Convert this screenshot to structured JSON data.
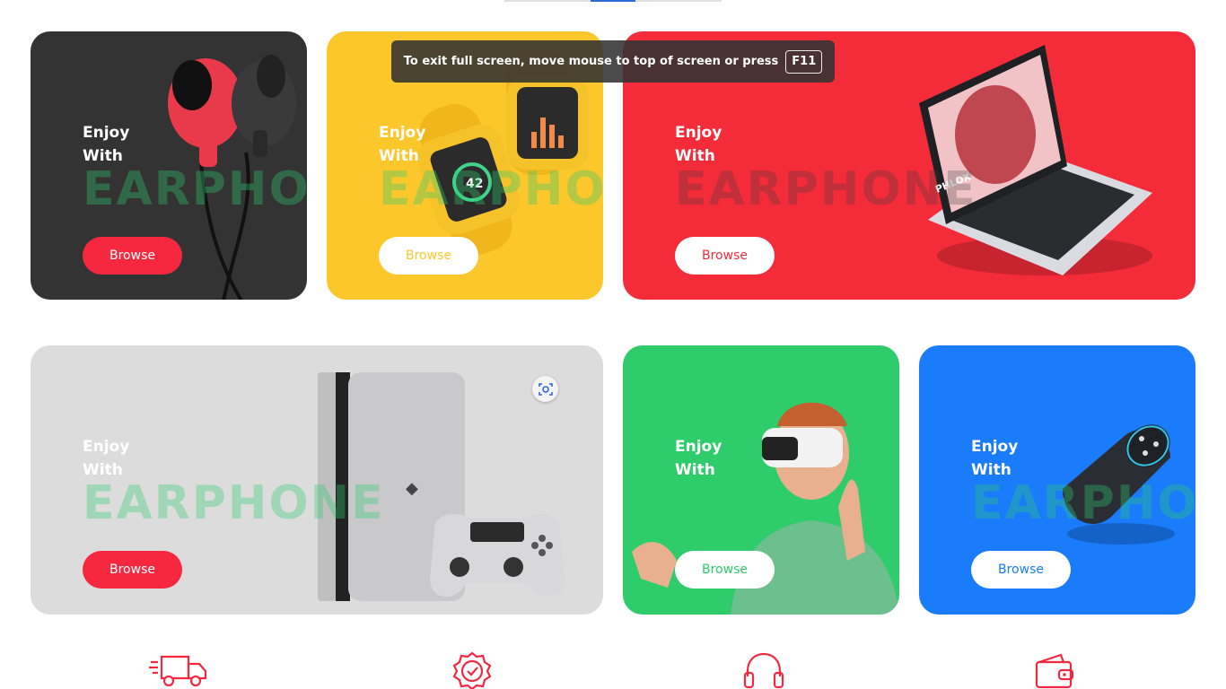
{
  "toast": {
    "message": "To exit full screen, move mouse to top of screen or press",
    "key": "F11"
  },
  "cards": [
    {
      "enjoy": "Enjoy",
      "with": "With",
      "watermark": "EARPHO",
      "button": "Browse",
      "bg": "#333333",
      "button_bg": "#f5283f",
      "button_color": "#ffffff"
    },
    {
      "enjoy": "Enjoy",
      "with": "With",
      "watermark": "EARPHO",
      "button": "Browse",
      "bg": "#fcc72b",
      "button_bg": "#ffffff",
      "button_color": "#fcc72b",
      "watch_reading": "42"
    },
    {
      "enjoy": "Enjoy",
      "with": "With",
      "watermark": "EARPHONE",
      "button": "Browse",
      "bg": "#f42c3a",
      "button_bg": "#ffffff",
      "button_color": "#f42c3a",
      "laptop_brand": "PHLOX"
    },
    {
      "enjoy": "Enjoy",
      "with": "With",
      "watermark": "EARPHONE",
      "button": "Browse",
      "bg": "#dcdcdc",
      "button_bg": "#f5283f",
      "button_color": "#ffffff"
    },
    {
      "enjoy": "Enjoy",
      "with": "With",
      "watermark": "",
      "button": "Browse",
      "bg": "#2ecc6a",
      "button_bg": "#ffffff",
      "button_color": "#2ecc6a"
    },
    {
      "enjoy": "Enjoy",
      "with": "With",
      "watermark": "EARPHO",
      "button": "Browse",
      "bg": "#1a7bfb",
      "button_bg": "#ffffff",
      "button_color": "#1a7bfb"
    }
  ],
  "features": [
    {
      "icon": "delivery-truck-icon"
    },
    {
      "icon": "verified-badge-icon"
    },
    {
      "icon": "headphones-icon"
    },
    {
      "icon": "wallet-icon"
    }
  ],
  "accent": "#f5283f"
}
